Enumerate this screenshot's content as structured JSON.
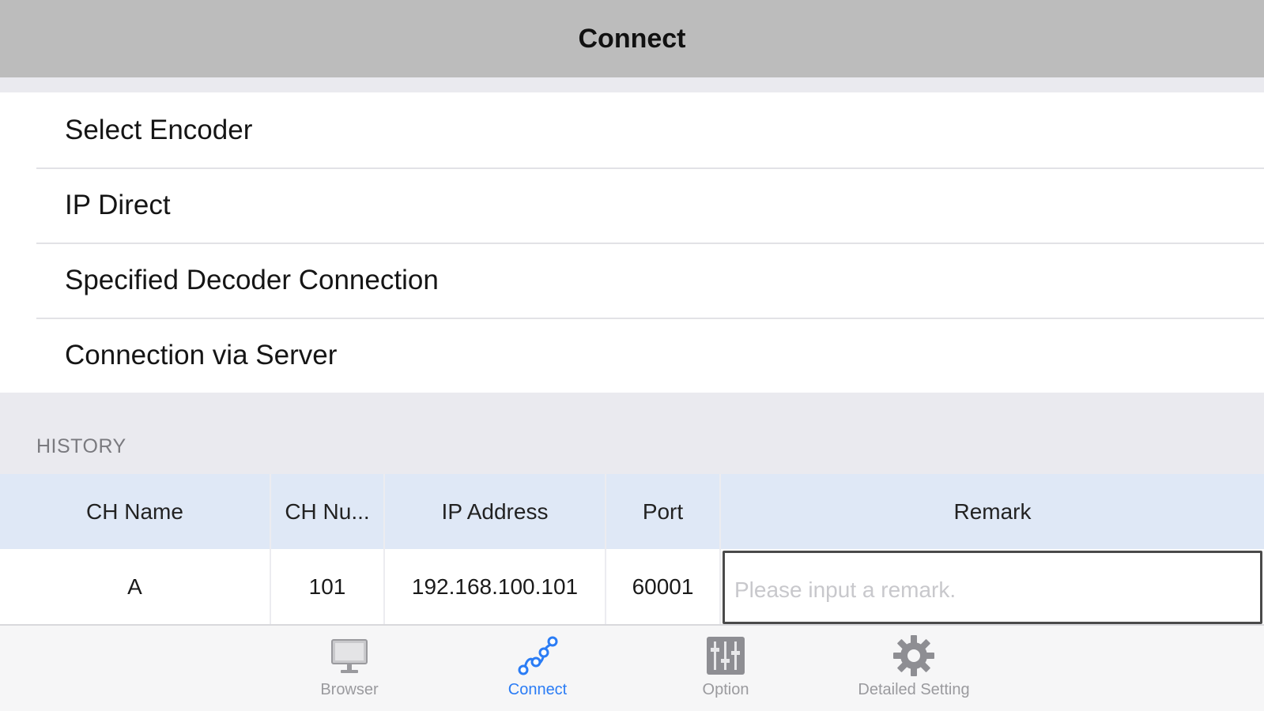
{
  "navbar": {
    "title": "Connect"
  },
  "menu": {
    "items": [
      {
        "label": "Select Encoder"
      },
      {
        "label": "IP Direct"
      },
      {
        "label": "Specified Decoder Connection"
      },
      {
        "label": "Connection via Server"
      }
    ]
  },
  "history": {
    "header": "HISTORY",
    "columns": [
      "CH Name",
      "CH Nu...",
      "IP Address",
      "Port",
      "Remark"
    ],
    "rows": [
      {
        "ch_name": "A",
        "ch_number": "101",
        "ip_address": "192.168.100.101",
        "port": "60001",
        "remark_value": "",
        "remark_placeholder": "Please input a remark."
      }
    ]
  },
  "tabbar": {
    "tabs": [
      {
        "label": "Browser",
        "icon": "monitor-icon",
        "active": false
      },
      {
        "label": "Connect",
        "icon": "connect-icon",
        "active": true
      },
      {
        "label": "Option",
        "icon": "sliders-icon",
        "active": false
      },
      {
        "label": "Detailed Setting",
        "icon": "gear-icon",
        "active": false
      }
    ]
  },
  "colors": {
    "navbar_bg": "#bcbcbc",
    "table_header_bg": "#dfe8f6",
    "accent": "#2a7cf5",
    "inactive_tab": "#9a9a9e"
  }
}
